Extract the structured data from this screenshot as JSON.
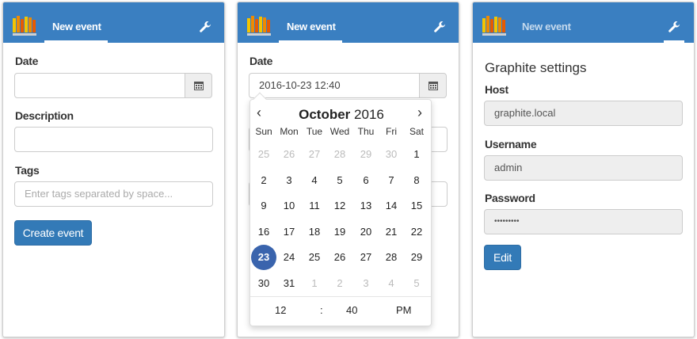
{
  "panels": {
    "header": {
      "tab_label": "New event"
    },
    "form": {
      "date_label": "Date",
      "description_label": "Description",
      "tags_label": "Tags",
      "tags_placeholder": "Enter tags separated by space...",
      "create_button": "Create event"
    },
    "picker": {
      "date_value": "2016-10-23 12:40",
      "month": "October",
      "year": "2016",
      "prev": "‹",
      "next": "›",
      "weekdays": [
        "Sun",
        "Mon",
        "Tue",
        "Wed",
        "Thu",
        "Fri",
        "Sat"
      ],
      "weeks": [
        [
          "25",
          "26",
          "27",
          "28",
          "29",
          "30",
          "1"
        ],
        [
          "2",
          "3",
          "4",
          "5",
          "6",
          "7",
          "8"
        ],
        [
          "9",
          "10",
          "11",
          "12",
          "13",
          "14",
          "15"
        ],
        [
          "16",
          "17",
          "18",
          "19",
          "20",
          "21",
          "22"
        ],
        [
          "23",
          "24",
          "25",
          "26",
          "27",
          "28",
          "29"
        ],
        [
          "30",
          "31",
          "1",
          "2",
          "3",
          "4",
          "5"
        ]
      ],
      "selected_day": "23",
      "hour": "12",
      "time_sep": ":",
      "minute": "40",
      "ampm": "PM"
    },
    "settings": {
      "title": "Graphite settings",
      "host_label": "Host",
      "host_value": "graphite.local",
      "username_label": "Username",
      "username_value": "admin",
      "password_label": "Password",
      "password_value": "•••••••••",
      "edit_button": "Edit"
    }
  },
  "colors": {
    "header": "#3a7fc1",
    "primary_button": "#337ab7",
    "selected_day": "#3a64ad"
  },
  "icons": {
    "logo": "bar-chart-logo-icon",
    "settings": "wrench-icon",
    "calendar": "calendar-icon"
  }
}
